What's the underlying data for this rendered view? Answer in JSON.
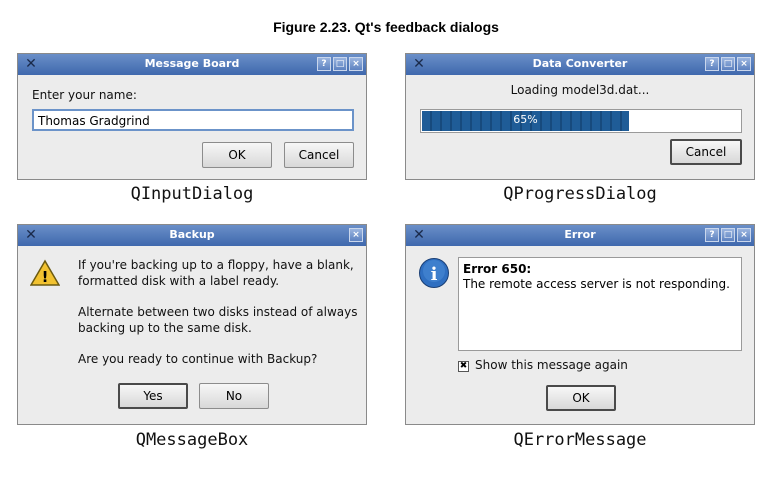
{
  "figure_title": "Figure 2.23. Qt's feedback dialogs",
  "input_dialog": {
    "title": "Message Board",
    "prompt": "Enter your name:",
    "value": "Thomas Gradgrind",
    "ok_label": "OK",
    "cancel_label": "Cancel",
    "caption": "QInputDialog",
    "title_buttons": [
      "?",
      "□",
      "×"
    ]
  },
  "progress_dialog": {
    "title": "Data Converter",
    "label": "Loading model3d.dat...",
    "progress_percent": 65,
    "progress_text": "65%",
    "cancel_label": "Cancel",
    "caption": "QProgressDialog",
    "title_buttons": [
      "?",
      "□",
      "×"
    ]
  },
  "message_box": {
    "title": "Backup",
    "paragraph1_line1": "If you're backing up to a floppy, have a blank,",
    "paragraph1_line2": "formatted disk with a label ready.",
    "paragraph2_line1": "Alternate between two disks instead of always",
    "paragraph2_line2": "backing up to the same disk.",
    "paragraph3": "Are you ready to continue with Backup?",
    "yes_label": "Yes",
    "no_label": "No",
    "caption": "QMessageBox",
    "icon": "warning-icon",
    "title_buttons": [
      "×"
    ]
  },
  "error_message": {
    "title": "Error",
    "heading": "Error 650:",
    "body": "The remote access server is not responding.",
    "checkbox_label": "Show this message again",
    "checkbox_checked": true,
    "checkbox_mark": "✖",
    "ok_label": "OK",
    "caption": "QErrorMessage",
    "icon": "info-icon",
    "title_buttons": [
      "?",
      "□",
      "×"
    ]
  },
  "icons": {
    "window_icon": "✕",
    "warning_glyph": "!",
    "info_glyph": "i"
  }
}
